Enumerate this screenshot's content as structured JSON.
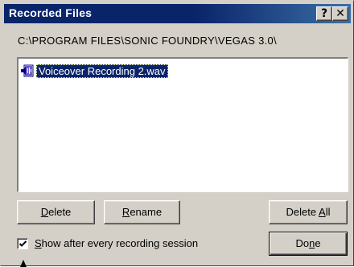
{
  "window": {
    "title": "Recorded Files",
    "help_label": "?",
    "close_label": "✕"
  },
  "path_label": "C:\\PROGRAM FILES\\SONIC FOUNDRY\\VEGAS 3.0\\",
  "files": [
    {
      "name": "Voiceover Recording 2.wav",
      "icon": "audio-file-icon",
      "selected": true
    }
  ],
  "buttons": {
    "delete": {
      "first": "D",
      "rest": "elete"
    },
    "rename": {
      "first": "R",
      "rest": "ename"
    },
    "delete_all": {
      "pre": "Delete ",
      "u": "A",
      "post": "ll"
    },
    "done": {
      "pre": "Do",
      "u": "n",
      "post": "e"
    }
  },
  "checkbox": {
    "checked": true,
    "first": "S",
    "rest": "how after every recording session"
  },
  "colors": {
    "titlebar": "#0a246a",
    "selection": "#0a246a",
    "face": "#d4d0c8"
  }
}
